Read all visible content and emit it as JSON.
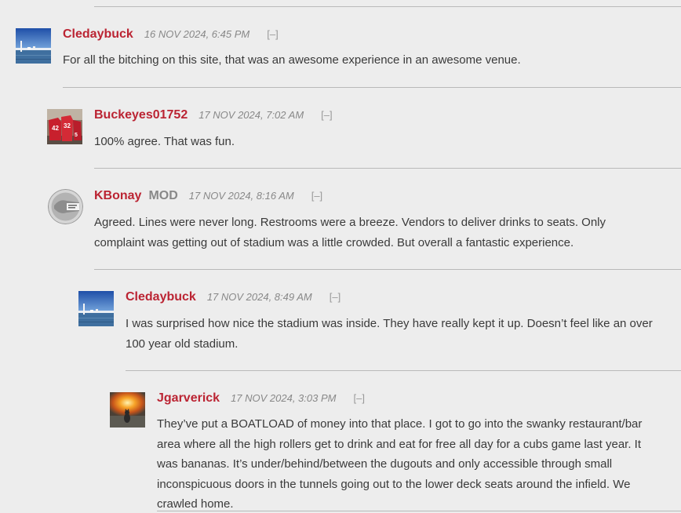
{
  "thread": {
    "comments": [
      {
        "author": "Cledaybuck",
        "is_mod": false,
        "timestamp": "16 NOV 2024, 6:45 PM",
        "collapse_label": "[–]",
        "avatar": "lake-photo-avatar",
        "body": "For all the bitching on this site, that was an awesome experience in an awesome venue."
      },
      {
        "author": "Buckeyes01752",
        "is_mod": false,
        "timestamp": "17 NOV 2024, 7:02 AM",
        "collapse_label": "[–]",
        "avatar": "jerseys-photo-avatar",
        "body": "100% agree. That was fun."
      },
      {
        "author": "KBonay",
        "is_mod": true,
        "mod_label": "MOD",
        "timestamp": "17 NOV 2024, 8:16 AM",
        "collapse_label": "[–]",
        "avatar": "gray-logo-avatar",
        "body": "Agreed. Lines were never long. Restrooms were a breeze. Vendors to deliver drinks to seats. Only complaint was getting out of stadium was a little crowded. But overall a fantastic experience."
      },
      {
        "author": "Cledaybuck",
        "is_mod": false,
        "timestamp": "17 NOV 2024, 8:49 AM",
        "collapse_label": "[–]",
        "avatar": "lake-photo-avatar",
        "body": "I was surprised how nice the stadium was inside. They have really kept it up. Doesn’t feel like an over 100 year old stadium."
      },
      {
        "author": "Jgarverick",
        "is_mod": false,
        "timestamp": "17 NOV 2024, 3:03 PM",
        "collapse_label": "[–]",
        "avatar": "explosion-cat-avatar",
        "body": "They’ve put a BOATLOAD of money into that place. I got to go into the swanky restaurant/bar area where all the high rollers get to drink and eat for free all day for a cubs game last year. It was bananas. It’s under/behind/between the dugouts and only accessible through small inconspicuous doors in the tunnels going out to the lower deck seats around the infield. We crawled home."
      }
    ]
  }
}
